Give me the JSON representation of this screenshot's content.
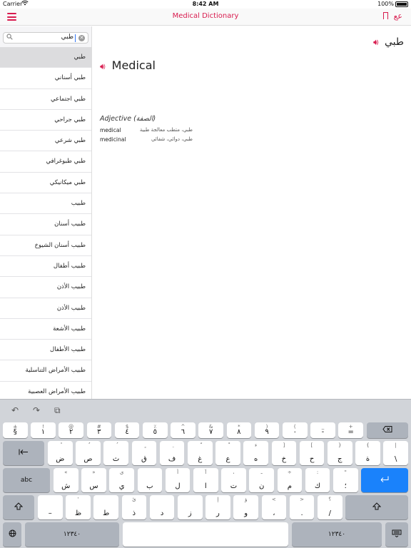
{
  "status": {
    "carrier": "Carrier",
    "wifi_icon": "wifi-icon",
    "time": "8:42 AM",
    "battery": "100%"
  },
  "nav": {
    "title": "Medical Dictionary",
    "menu_icon": "hamburger-icon",
    "lang_label": "عع",
    "bookmark_icon": "bookmark-icon"
  },
  "colors": {
    "accent": "#d81b4e",
    "keyboard_bg": "#d1d4d9",
    "return_key": "#1a82fb"
  },
  "search": {
    "value": "طبي"
  },
  "list": [
    "طبي",
    "طبي أسناني",
    "طبي اجتماعي",
    "طبي جراحي",
    "طبي شرعي",
    "طبي طبوغرافي",
    "طبي ميكانيكي",
    "طبيب",
    "طبيب أسنان",
    "طبيب أسنان الشيوخ",
    "طبيب أطفال",
    "طبيب الأذن",
    "طبيب الأذن",
    "طبيب الأشعة",
    "طبيب الأطفال",
    "طبيب الأمراض التناسلية",
    "طبيب الأمراض العصبية"
  ],
  "entry": {
    "headword_ar": "طبي",
    "headword_en": "Medical",
    "pos": "Adjective (الصفة)",
    "senses": [
      {
        "en": "medical",
        "ar": "طبي، متطب معالجة طبية"
      },
      {
        "en": "medicinal",
        "ar": "طبي، دوائي، شفائي"
      }
    ]
  },
  "keyboard": {
    "toolbar": [
      "↶",
      "↷",
      "⧉"
    ],
    "row1": [
      {
        "t": "±",
        "b": "§"
      },
      {
        "t": "!",
        "b": "١"
      },
      {
        "t": "@",
        "b": "٢"
      },
      {
        "t": "#",
        "b": "٣"
      },
      {
        "t": "$",
        "b": "٤"
      },
      {
        "t": "٪",
        "b": "٥"
      },
      {
        "t": "^",
        "b": "٦"
      },
      {
        "t": "&",
        "b": "٧"
      },
      {
        "t": "*",
        "b": "٨"
      },
      {
        "t": ")",
        "b": "٩"
      },
      {
        "t": "(",
        "b": "٠"
      },
      {
        "t": "_",
        "b": "-"
      },
      {
        "t": "+",
        "b": "="
      }
    ],
    "row2": [
      {
        "t": "ً",
        "b": "ض"
      },
      {
        "t": "ٌ",
        "b": "ص"
      },
      {
        "t": "ُ",
        "b": "ث"
      },
      {
        "t": "ٍ",
        "b": "ق"
      },
      {
        "t": "ِ",
        "b": "ف"
      },
      {
        "t": "ّ",
        "b": "غ"
      },
      {
        "t": "ْ",
        "b": "ع"
      },
      {
        "t": "ء",
        "b": "ه"
      },
      {
        "t": "]",
        "b": "خ"
      },
      {
        "t": "[",
        "b": "ح"
      },
      {
        "t": "}",
        "b": "ج"
      },
      {
        "t": "{",
        "b": "ة"
      },
      {
        "t": "|",
        "b": "\\"
      }
    ],
    "row3": [
      {
        "t": "«",
        "b": "ش"
      },
      {
        "t": "»",
        "b": "س"
      },
      {
        "t": "ى",
        "b": "ي"
      },
      {
        "t": "",
        "b": "ب"
      },
      {
        "t": "أ",
        "b": "ل"
      },
      {
        "t": "آ",
        "b": "ا"
      },
      {
        "t": "،",
        "b": "ت"
      },
      {
        "t": "ـ",
        "b": "ن"
      },
      {
        "t": "÷",
        "b": "م"
      },
      {
        "t": ":",
        "b": "ك"
      },
      {
        "t": "\"",
        "b": "؛"
      }
    ],
    "row4": [
      {
        "t": "",
        "b": "–"
      },
      {
        "t": "’",
        "b": "ظ"
      },
      {
        "t": "",
        "b": "ط"
      },
      {
        "t": "ئ",
        "b": "ذ"
      },
      {
        "t": "",
        "b": "د"
      },
      {
        "t": "",
        "b": "ز"
      },
      {
        "t": "إ",
        "b": "ر"
      },
      {
        "t": "ؤ",
        "b": "و"
      },
      {
        "t": "<",
        "b": "،"
      },
      {
        "t": ">",
        "b": "."
      },
      {
        "t": "؟",
        "b": "/"
      }
    ],
    "abc_label": "abc",
    "numbers_label": "١٢٣٤٠",
    "numbers_label_right": "١٢٣٤٠",
    "return_icon": "return-icon",
    "delete_icon": "delete-icon",
    "tab_icon": "tab-icon",
    "shift_icon": "shift-icon",
    "globe_icon": "globe-icon",
    "hide_icon": "keyboard-hide-icon"
  }
}
